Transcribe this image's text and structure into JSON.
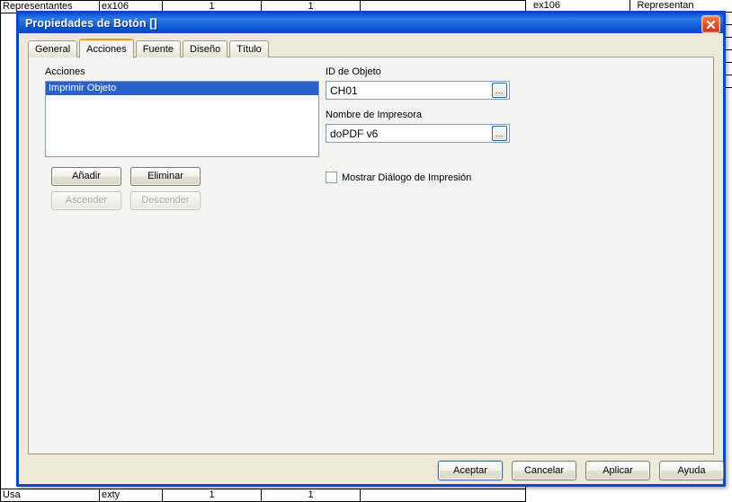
{
  "background": {
    "top_row": {
      "label": "Representantes",
      "code": "ex106",
      "col3": "1",
      "col4": "1"
    },
    "bottom_row": {
      "label": "Usa",
      "code": "exty",
      "col3": "1",
      "col4": "1"
    },
    "top_right_row": {
      "code": "ex106",
      "label": "Representan"
    },
    "filler_rows": [
      {
        "c1": "",
        "c2": ""
      },
      {
        "c1": "",
        "c2": ""
      },
      {
        "c1": "",
        "c2": ""
      },
      {
        "c1": "",
        "c2": ""
      },
      {
        "c1": "",
        "c2": ""
      },
      {
        "c1": "",
        "c2": ""
      }
    ]
  },
  "dialog": {
    "title": "Propiedades de Botón []",
    "close_icon": "close-icon",
    "accent_selected_tab": "#F0A017",
    "title_bar_color": "#0A48C8",
    "body_color": "#ECE9D8",
    "panel_color": "#F3F3F0",
    "selection_color": "#2B5FC9",
    "tabs": [
      {
        "label": "General",
        "selected": false
      },
      {
        "label": "Acciones",
        "selected": true
      },
      {
        "label": "Fuente",
        "selected": false
      },
      {
        "label": "Diseño",
        "selected": false
      },
      {
        "label": "Título",
        "selected": false
      }
    ],
    "acciones_tab": {
      "actions_label": "Acciones",
      "actions_list": [
        {
          "label": "Imprimir Objeto",
          "selected": true
        }
      ],
      "buttons": {
        "add": "Añadir",
        "remove": "Eliminar",
        "move_up": "Ascender",
        "move_down": "Descender"
      },
      "object_id": {
        "label": "ID de Objeto",
        "value": "CH01",
        "placeholder": "",
        "browse_label": "..."
      },
      "printer_name": {
        "label": "Nombre de Impresora",
        "value": "doPDF v6",
        "placeholder": "",
        "browse_label": "..."
      },
      "show_print_dialog": {
        "label": "Mostrar Diálogo de Impresión",
        "checked": false
      }
    },
    "footer_buttons": {
      "accept": "Aceptar",
      "cancel": "Cancelar",
      "apply": "Aplicar",
      "help": "Ayuda"
    }
  }
}
